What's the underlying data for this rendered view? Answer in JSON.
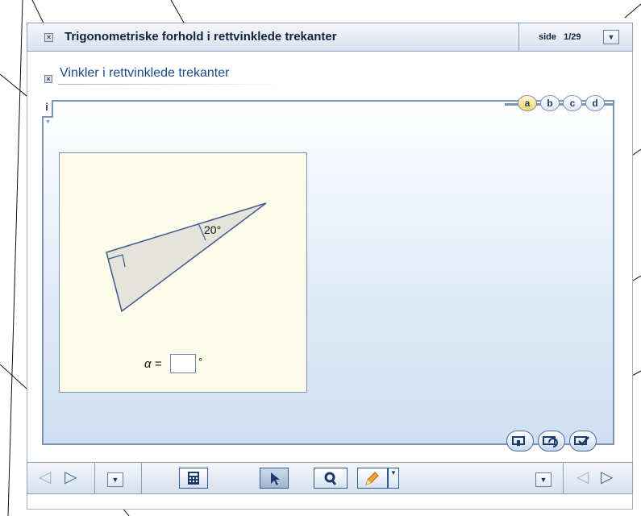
{
  "window": {
    "title": "Trigonometriske forhold i rettvinklede trekanter",
    "page_label": "side",
    "page_current": "1",
    "page_total": "/29",
    "dropdown_glyph": "▼"
  },
  "section": {
    "title": "Vinkler i rettvinklede trekanter"
  },
  "info_tab": "i",
  "subtabs": [
    "a",
    "b",
    "c",
    "d"
  ],
  "active_subtab": "a",
  "drawing": {
    "angle_label": "20°",
    "answer_label": "α =",
    "answer_value": "",
    "degree_symbol": "°"
  },
  "icons": {
    "close": "close-icon",
    "calculator": "calculator-icon",
    "pointer": "pointer-icon",
    "magnifier": "magnifier-icon",
    "pencil": "pencil-icon",
    "hint": "hint-icon",
    "reset": "reset-icon",
    "check": "check-icon"
  },
  "colors": {
    "accent": "#1b3a6b",
    "panel_border": "#7d93b4",
    "drawing_bg": "#fdfbe9",
    "active_tab": "#f4d76a"
  }
}
